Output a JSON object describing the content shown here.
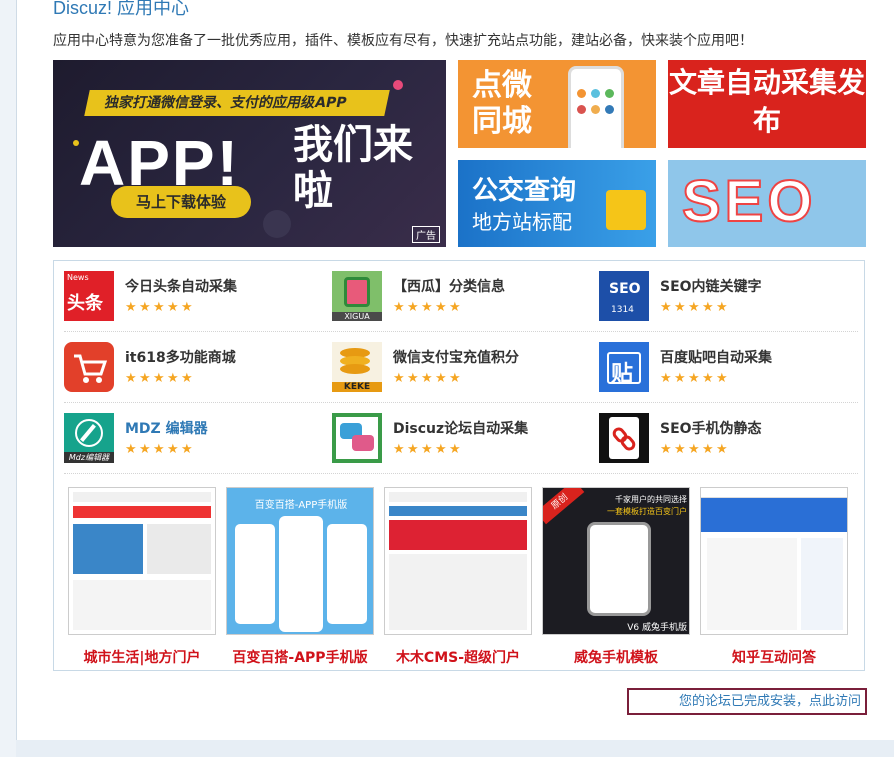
{
  "header": {
    "title": "Discuz! 应用中心",
    "subtitle": "应用中心特意为您准备了一批优秀应用，插件、模板应有尽有，快速扩充站点功能，建站必备，快来装个应用吧！"
  },
  "banners": {
    "app": {
      "slogan": "独家打通微信登录、支付的应用级APP",
      "big": "APP!",
      "big2": "我们来啦",
      "button": "马上下载体验",
      "tag": "广告"
    },
    "city": {
      "text": "点微同城"
    },
    "article": {
      "text": "文章自动采集发布"
    },
    "bus": {
      "line1": "公交查询",
      "line2": "地方站标配"
    },
    "seo": {
      "text": "SEO"
    }
  },
  "apps": [
    {
      "name": "今日头条自动采集",
      "icon": "toutiao-icon",
      "icon_text": "头条",
      "icon_sub": "News",
      "color": "#e02028",
      "stars": 5
    },
    {
      "name": "【西瓜】分类信息",
      "icon": "watermelon-icon",
      "icon_text": "XIGUA",
      "color": "#7fbf6a",
      "stars": 5
    },
    {
      "name": "SEO内链关键字",
      "icon": "seo-puzzle-icon",
      "icon_text": "SEO",
      "icon_sub": "1314",
      "color": "#1d4fa8",
      "stars": 5
    },
    {
      "name": "it618多功能商城",
      "icon": "shopping-cart-icon",
      "icon_text": "",
      "color": "#e2402a",
      "stars": 5
    },
    {
      "name": "微信支付宝充值积分",
      "icon": "coins-icon",
      "icon_text": "KEKE",
      "color": "#e79a12",
      "stars": 5
    },
    {
      "name": "百度贴吧自动采集",
      "icon": "tieba-icon",
      "icon_text": "贴",
      "color": "#2970d9",
      "stars": 5
    },
    {
      "name": "MDZ 编辑器",
      "icon": "pencil-icon",
      "icon_text": "Mdz编辑器",
      "color": "#16a38c",
      "stars": 5
    },
    {
      "name": "Discuz论坛自动采集",
      "icon": "chat-bubbles-icon",
      "icon_text": "",
      "color": "#3a9b48",
      "stars": 5
    },
    {
      "name": "SEO手机伪静态",
      "icon": "chain-link-icon",
      "icon_text": "",
      "color": "#111111",
      "stars": 5
    }
  ],
  "star_glyph": "★",
  "themes": [
    {
      "label": "城市生活|地方门户"
    },
    {
      "label": "百变百搭-APP手机版",
      "thumb_title": "百变百搭-APP手机版"
    },
    {
      "label": "木木CMS-超级门户"
    },
    {
      "label": "威兔手机模板",
      "thumb_badge": "原创",
      "thumb_top": "千家用户的共同选择",
      "thumb_sub": "一套模板打造百变门户",
      "thumb_bottom": "V6 威兔手机版"
    },
    {
      "label": "知乎互动问答"
    }
  ],
  "visit_link": "您的论坛已完成安装，点此访问"
}
